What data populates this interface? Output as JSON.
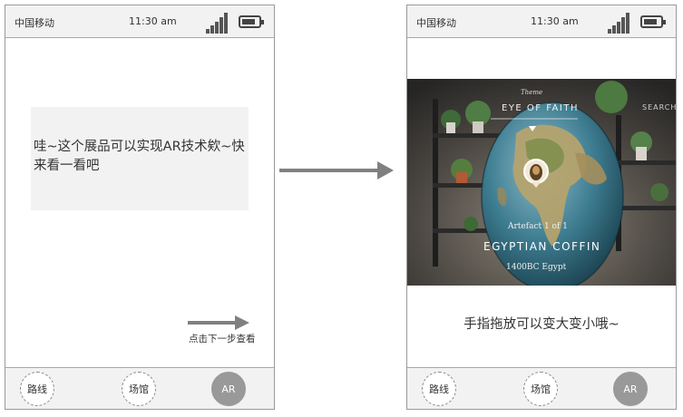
{
  "status_bar": {
    "carrier": "中国移动",
    "time": "11:30 am",
    "signal_bars": 5,
    "battery_level": 0.85
  },
  "screen_1": {
    "message": "哇~这个展品可以实现AR技术欸~快来看一看吧",
    "next_step": "点击下一步查看"
  },
  "screen_2": {
    "ar_overlay": {
      "theme_label": "Theme",
      "exhibit_title": "EYE OF FAITH",
      "search_label": "SEARCHIN",
      "artefact_count": "Artefact 1 of 1",
      "artefact_name": "EGYPTIAN COFFIN",
      "artefact_origin": "1400BC Egypt"
    },
    "hint": "手指拖放可以变大变小哦~"
  },
  "tab_bar": {
    "items": [
      "路线",
      "场馆",
      "AR"
    ],
    "active": "AR"
  },
  "colors": {
    "panel_gray": "#f2f2f2",
    "active_tab": "#999999",
    "arrow": "#808080",
    "border": "#9a9a9a"
  }
}
